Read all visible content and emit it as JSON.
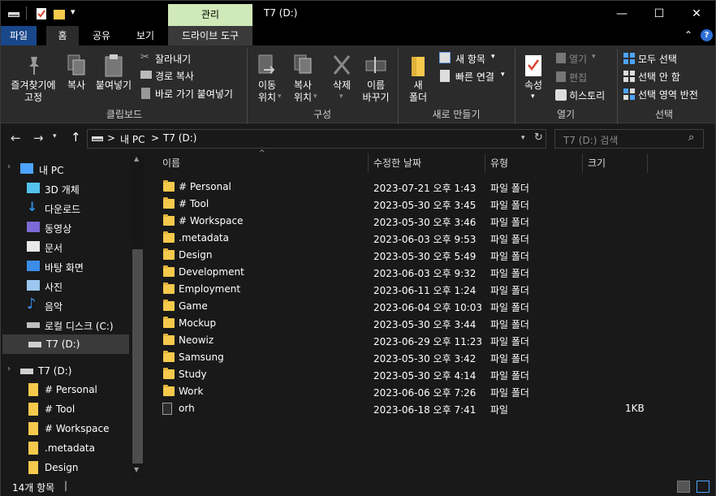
{
  "window": {
    "title": "T7 (D:)",
    "context_tab": "관리",
    "controls": {
      "minimize": "—",
      "maximize": "☐",
      "close": "✕"
    }
  },
  "tabs": {
    "file": "파일",
    "home": "홈",
    "share": "공유",
    "view": "보기",
    "drive_tools": "드라이브 도구"
  },
  "ribbon": {
    "clipboard": {
      "pin_label": "즐겨찾기에\n고정",
      "copy": "복사",
      "paste": "붙여넣기",
      "cut": "잘라내기",
      "copy_path": "경로 복사",
      "paste_shortcut": "바로 가기 붙여넣기",
      "group": "클립보드"
    },
    "organize": {
      "move_to": "이동\n위치",
      "copy_to": "복사\n위치",
      "delete": "삭제",
      "rename": "이름\n바꾸기",
      "group": "구성"
    },
    "new": {
      "new_folder": "새\n폴더",
      "new_item": "새 항목",
      "easy_access": "빠른 연결",
      "group": "새로 만들기"
    },
    "open": {
      "properties": "속성",
      "open": "열기",
      "edit": "편집",
      "history": "히스토리",
      "group": "열기"
    },
    "select": {
      "select_all": "모두 선택",
      "select_none": "선택 안 함",
      "invert": "선택 영역 반전",
      "group": "선택"
    }
  },
  "address": {
    "path": [
      "내 PC",
      "T7 (D:)"
    ],
    "separator": ">",
    "search_placeholder": "T7 (D:) 검색"
  },
  "nav_pane": {
    "items": [
      {
        "label": "내 PC",
        "icon": "pc-icon"
      },
      {
        "label": "3D 개체",
        "icon": "3d-objects-icon"
      },
      {
        "label": "다운로드",
        "icon": "download-icon"
      },
      {
        "label": "동영상",
        "icon": "video-icon"
      },
      {
        "label": "문서",
        "icon": "document-icon"
      },
      {
        "label": "바탕 화면",
        "icon": "desktop-icon"
      },
      {
        "label": "사진",
        "icon": "pictures-icon"
      },
      {
        "label": "음악",
        "icon": "music-icon"
      },
      {
        "label": "로컬 디스크 (C:)",
        "icon": "local-disk-icon"
      },
      {
        "label": "T7 (D:)",
        "icon": "drive-icon"
      },
      {
        "label": "T7 (D:)",
        "icon": "drive-icon"
      },
      {
        "label": "# Personal",
        "icon": "folder-icon"
      },
      {
        "label": "# Tool",
        "icon": "folder-icon"
      },
      {
        "label": "# Workspace",
        "icon": "folder-icon"
      },
      {
        "label": ".metadata",
        "icon": "folder-icon"
      },
      {
        "label": "Design",
        "icon": "folder-icon"
      }
    ]
  },
  "file_list": {
    "columns": [
      "이름",
      "수정한 날짜",
      "유형",
      "크기"
    ],
    "rows": [
      {
        "name": "# Personal",
        "date": "2023-07-21 오후 1:43",
        "type": "파일 폴더",
        "size": "",
        "kind": "folder"
      },
      {
        "name": "# Tool",
        "date": "2023-05-30 오후 3:45",
        "type": "파일 폴더",
        "size": "",
        "kind": "folder"
      },
      {
        "name": "# Workspace",
        "date": "2023-05-30 오후 3:46",
        "type": "파일 폴더",
        "size": "",
        "kind": "folder"
      },
      {
        "name": ".metadata",
        "date": "2023-06-03 오후 9:53",
        "type": "파일 폴더",
        "size": "",
        "kind": "folder"
      },
      {
        "name": "Design",
        "date": "2023-05-30 오후 5:49",
        "type": "파일 폴더",
        "size": "",
        "kind": "folder"
      },
      {
        "name": "Development",
        "date": "2023-06-03 오후 9:32",
        "type": "파일 폴더",
        "size": "",
        "kind": "folder"
      },
      {
        "name": "Employment",
        "date": "2023-06-11 오후 1:24",
        "type": "파일 폴더",
        "size": "",
        "kind": "folder"
      },
      {
        "name": "Game",
        "date": "2023-06-04 오후 10:03",
        "type": "파일 폴더",
        "size": "",
        "kind": "folder"
      },
      {
        "name": "Mockup",
        "date": "2023-05-30 오후 3:44",
        "type": "파일 폴더",
        "size": "",
        "kind": "folder"
      },
      {
        "name": "Neowiz",
        "date": "2023-06-29 오후 11:23",
        "type": "파일 폴더",
        "size": "",
        "kind": "folder"
      },
      {
        "name": "Samsung",
        "date": "2023-05-30 오후 3:42",
        "type": "파일 폴더",
        "size": "",
        "kind": "folder"
      },
      {
        "name": "Study",
        "date": "2023-05-30 오후 4:14",
        "type": "파일 폴더",
        "size": "",
        "kind": "folder"
      },
      {
        "name": "Work",
        "date": "2023-06-06 오후 7:26",
        "type": "파일 폴더",
        "size": "",
        "kind": "folder"
      },
      {
        "name": "orh",
        "date": "2023-06-18 오후 7:41",
        "type": "파일",
        "size": "1KB",
        "kind": "file"
      }
    ]
  },
  "status": {
    "item_count": "14개 항목"
  },
  "colors": {
    "accent": "#19478a",
    "context_tab": "#cfe9b8",
    "folder": "#f5c94c",
    "background": "#191919",
    "ribbon": "#2b2b2b"
  }
}
